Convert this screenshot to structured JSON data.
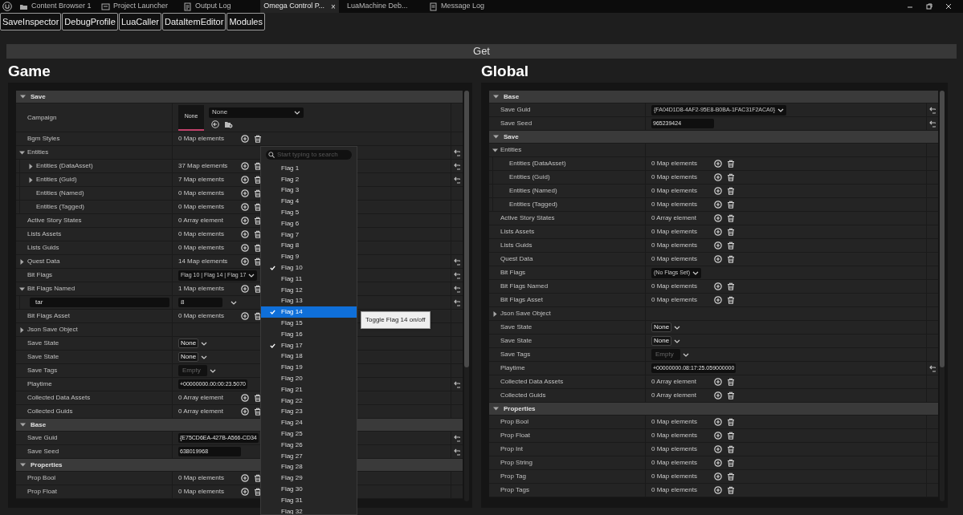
{
  "tabs": [
    {
      "label": "Content Browser 1",
      "selected": false
    },
    {
      "label": "Project Launcher",
      "selected": false
    },
    {
      "label": "Output Log",
      "selected": false
    },
    {
      "label": "Omega Control P...",
      "selected": true
    },
    {
      "label": "LuaMachine Deb...",
      "selected": false
    },
    {
      "label": "Message Log",
      "selected": false
    }
  ],
  "close_glyph": "×",
  "toolbar": [
    "SaveInspector",
    "DebugProfile",
    "LuaCaller",
    "DataItemEditor",
    "Modules"
  ],
  "get_button": "Get",
  "panels": [
    {
      "title": "Game",
      "sections": [
        {
          "label": "Save",
          "expanded": true,
          "children": [
            {
              "kind": "asset",
              "label": "Campaign",
              "thumb": "None",
              "value": "None"
            },
            {
              "kind": "count",
              "label": "Bgm Styles",
              "value": "0 Map elements"
            },
            {
              "kind": "group",
              "label": "Entities",
              "expanded": true,
              "resettable": true,
              "children": [
                {
                  "kind": "count",
                  "label": "Entities (DataAsset)",
                  "value": "37 Map elements",
                  "expanded": false,
                  "resettable": true
                },
                {
                  "kind": "count",
                  "label": "Entities (Guid)",
                  "value": "7 Map elements",
                  "expanded": false,
                  "resettable": true
                },
                {
                  "kind": "count",
                  "label": "Entities (Named)",
                  "value": "0 Map elements"
                },
                {
                  "kind": "count",
                  "label": "Entities (Tagged)",
                  "value": "0 Map elements"
                }
              ]
            },
            {
              "kind": "count",
              "label": "Active Story States",
              "value": "0 Array element"
            },
            {
              "kind": "count",
              "label": "Lists Assets",
              "value": "0 Map elements"
            },
            {
              "kind": "count",
              "label": "Lists Guids",
              "value": "0 Map elements"
            },
            {
              "kind": "count",
              "label": "Quest Data",
              "value": "14 Map elements",
              "expanded": false,
              "resettable": true
            },
            {
              "kind": "combo",
              "label": "Bit Flags",
              "value": "Flag 10 | Flag 14 | Flag 17",
              "resettable": true
            },
            {
              "kind": "count",
              "label": "Bit Flags Named",
              "value": "1 Map elements",
              "expanded": true,
              "resettable": true,
              "children": [
                {
                  "kind": "pair",
                  "key": "tar",
                  "value": "8",
                  "resettable": true
                }
              ]
            },
            {
              "kind": "count",
              "label": "Bit Flags Asset",
              "value": "0 Map elements"
            },
            {
              "kind": "group",
              "label": "Json Save Object",
              "expanded": false
            },
            {
              "kind": "enum",
              "label": "Save State",
              "value": "None"
            },
            {
              "kind": "enum",
              "label": "Save State",
              "value": "None"
            },
            {
              "kind": "tags",
              "label": "Save Tags",
              "placeholder": "Empty"
            },
            {
              "kind": "text",
              "label": "Playtime",
              "value": "+00000000.00:00:23.5070",
              "resettable": true
            },
            {
              "kind": "count",
              "label": "Collected Data Assets",
              "value": "0 Array element"
            },
            {
              "kind": "count",
              "label": "Collected Guids",
              "value": "0 Array element"
            }
          ]
        },
        {
          "label": "Base",
          "expanded": true,
          "children": [
            {
              "kind": "text",
              "label": "Save Guid",
              "value": "{E75CD6EA-427B-A566-CD34",
              "resettable": true
            },
            {
              "kind": "text",
              "label": "Save Seed",
              "value": "638019968",
              "resettable": true
            }
          ]
        },
        {
          "label": "Properties",
          "expanded": true,
          "children": [
            {
              "kind": "count",
              "label": "Prop Bool",
              "value": "0 Map elements"
            },
            {
              "kind": "count",
              "label": "Prop Float",
              "value": "0 Map elements"
            }
          ]
        }
      ]
    },
    {
      "title": "Global",
      "sections": [
        {
          "label": "Base",
          "expanded": true,
          "children": [
            {
              "kind": "combo",
              "label": "Save Guid",
              "value": "{FA04D1D8-4AF2-95E8-B0BA-1FAC31F2ACA0}",
              "resettable": true
            },
            {
              "kind": "text",
              "label": "Save Seed",
              "value": "965239424",
              "resettable": true
            }
          ]
        },
        {
          "label": "Save",
          "expanded": true,
          "children": [
            {
              "kind": "group",
              "label": "Entities",
              "expanded": true,
              "children": [
                {
                  "kind": "count",
                  "label": "Entities (DataAsset)",
                  "value": "0 Map elements"
                },
                {
                  "kind": "count",
                  "label": "Entities (Guid)",
                  "value": "0 Map elements"
                },
                {
                  "kind": "count",
                  "label": "Entities (Named)",
                  "value": "0 Map elements"
                },
                {
                  "kind": "count",
                  "label": "Entities (Tagged)",
                  "value": "0 Map elements"
                }
              ]
            },
            {
              "kind": "count",
              "label": "Active Story States",
              "value": "0 Array element"
            },
            {
              "kind": "count",
              "label": "Lists Assets",
              "value": "0 Map elements"
            },
            {
              "kind": "count",
              "label": "Lists Guids",
              "value": "0 Map elements"
            },
            {
              "kind": "count",
              "label": "Quest Data",
              "value": "0 Map elements"
            },
            {
              "kind": "combo",
              "label": "Bit Flags",
              "value": "(No Flags Set)"
            },
            {
              "kind": "count",
              "label": "Bit Flags Named",
              "value": "0 Map elements"
            },
            {
              "kind": "count",
              "label": "Bit Flags Asset",
              "value": "0 Map elements"
            },
            {
              "kind": "group",
              "label": "Json Save Object",
              "expanded": false
            },
            {
              "kind": "enum",
              "label": "Save State",
              "value": "None"
            },
            {
              "kind": "enum",
              "label": "Save State",
              "value": "None"
            },
            {
              "kind": "tags",
              "label": "Save Tags",
              "placeholder": "Empty"
            },
            {
              "kind": "text",
              "label": "Playtime",
              "value": "+00000000.08:17:25.059000000",
              "resettable": true
            },
            {
              "kind": "count",
              "label": "Collected Data Assets",
              "value": "0 Array element"
            },
            {
              "kind": "count",
              "label": "Collected Guids",
              "value": "0 Array element"
            }
          ]
        },
        {
          "label": "Properties",
          "expanded": true,
          "children": [
            {
              "kind": "count",
              "label": "Prop Bool",
              "value": "0 Map elements"
            },
            {
              "kind": "count",
              "label": "Prop Float",
              "value": "0 Map elements"
            },
            {
              "kind": "count",
              "label": "Prop Int",
              "value": "0 Map elements"
            },
            {
              "kind": "count",
              "label": "Prop String",
              "value": "0 Map elements"
            },
            {
              "kind": "count",
              "label": "Prop Tag",
              "value": "0 Map elements"
            },
            {
              "kind": "count",
              "label": "Prop Tags",
              "value": "0 Map elements"
            }
          ]
        }
      ]
    }
  ],
  "flags_menu": {
    "search_placeholder": "Start typing to search",
    "items": [
      {
        "label": "Flag 1",
        "checked": false,
        "selected": false
      },
      {
        "label": "Flag 2",
        "checked": false,
        "selected": false
      },
      {
        "label": "Flag 3",
        "checked": false,
        "selected": false
      },
      {
        "label": "Flag 4",
        "checked": false,
        "selected": false
      },
      {
        "label": "Flag 5",
        "checked": false,
        "selected": false
      },
      {
        "label": "Flag 6",
        "checked": false,
        "selected": false
      },
      {
        "label": "Flag 7",
        "checked": false,
        "selected": false
      },
      {
        "label": "Flag 8",
        "checked": false,
        "selected": false
      },
      {
        "label": "Flag 9",
        "checked": false,
        "selected": false
      },
      {
        "label": "Flag 10",
        "checked": true,
        "selected": false
      },
      {
        "label": "Flag 11",
        "checked": false,
        "selected": false
      },
      {
        "label": "Flag 12",
        "checked": false,
        "selected": false
      },
      {
        "label": "Flag 13",
        "checked": false,
        "selected": false
      },
      {
        "label": "Flag 14",
        "checked": true,
        "selected": true
      },
      {
        "label": "Flag 15",
        "checked": false,
        "selected": false
      },
      {
        "label": "Flag 16",
        "checked": false,
        "selected": false
      },
      {
        "label": "Flag 17",
        "checked": true,
        "selected": false
      },
      {
        "label": "Flag 18",
        "checked": false,
        "selected": false
      },
      {
        "label": "Flag 19",
        "checked": false,
        "selected": false
      },
      {
        "label": "Flag 20",
        "checked": false,
        "selected": false
      },
      {
        "label": "Flag 21",
        "checked": false,
        "selected": false
      },
      {
        "label": "Flag 22",
        "checked": false,
        "selected": false
      },
      {
        "label": "Flag 23",
        "checked": false,
        "selected": false
      },
      {
        "label": "Flag 24",
        "checked": false,
        "selected": false
      },
      {
        "label": "Flag 25",
        "checked": false,
        "selected": false
      },
      {
        "label": "Flag 26",
        "checked": false,
        "selected": false
      },
      {
        "label": "Flag 27",
        "checked": false,
        "selected": false
      },
      {
        "label": "Flag 28",
        "checked": false,
        "selected": false
      },
      {
        "label": "Flag 29",
        "checked": false,
        "selected": false
      },
      {
        "label": "Flag 30",
        "checked": false,
        "selected": false
      },
      {
        "label": "Flag 31",
        "checked": false,
        "selected": false
      },
      {
        "label": "Flag 32",
        "checked": false,
        "selected": false
      }
    ],
    "tooltip": "Toggle Flag 14 on/off"
  }
}
